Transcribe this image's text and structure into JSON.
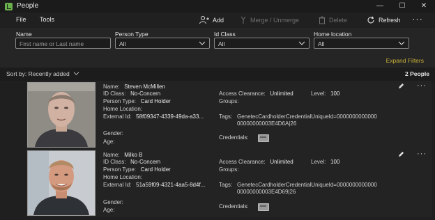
{
  "window": {
    "title": "People"
  },
  "menu": [
    "File",
    "Tools"
  ],
  "toolbar": {
    "add": "Add",
    "merge": "Merge / Unmerge",
    "delete": "Delete",
    "refresh": "Refresh"
  },
  "filters": {
    "name": {
      "label": "Name",
      "placeholder": "First name or Last name"
    },
    "person_type": {
      "label": "Person Type",
      "value": "All"
    },
    "id_class": {
      "label": "Id Class",
      "value": "All"
    },
    "home_location": {
      "label": "Home location",
      "value": "All"
    },
    "expand": "Expand Filters"
  },
  "list": {
    "sort_label": "Sort by: Recently added",
    "count": "2 People"
  },
  "field_labels": {
    "name": "Name:",
    "id_class": "ID Class:",
    "person_type": "Person Type:",
    "home_location": "Home Location:",
    "external_id": "External Id:",
    "gender": "Gender:",
    "age": "Age:",
    "access_clearance": "Access Clearance:",
    "level": "Level:",
    "groups": "Groups:",
    "tags": "Tags:",
    "credentials": "Credentials:"
  },
  "people": [
    {
      "name": "Steven McMillen",
      "id_class": "No-Concern",
      "person_type": "Card Holder",
      "external_id": "58f09347-4339-49da-a33...",
      "access_clearance": "Unlimited",
      "level": "100",
      "tags_line1": "GenetecCardholderCredentialUniqueId=0000000000000",
      "tags_line2": "00000000003E4D6A|26"
    },
    {
      "name": "Milko B",
      "id_class": "No-Concern",
      "person_type": "Card Holder",
      "external_id": "51a59f09-4321-4aa5-8d4f...",
      "access_clearance": "Unlimited",
      "level": "100",
      "tags_line1": "GenetecCardholderCredentialUniqueId=0000000000000",
      "tags_line2": "00000000003E4D69|26"
    }
  ]
}
